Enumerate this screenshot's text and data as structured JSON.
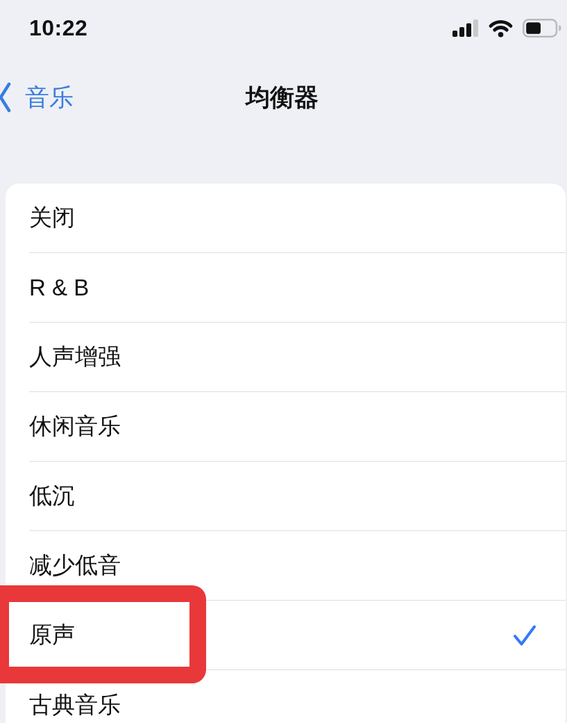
{
  "status_bar": {
    "time": "10:22"
  },
  "nav_bar": {
    "back_label": "音乐",
    "title": "均衡器"
  },
  "items": [
    {
      "label": "关闭",
      "selected": false,
      "highlighted": false
    },
    {
      "label": "R & B",
      "selected": false,
      "highlighted": false
    },
    {
      "label": "人声增强",
      "selected": false,
      "highlighted": false
    },
    {
      "label": "休闲音乐",
      "selected": false,
      "highlighted": false
    },
    {
      "label": "低沉",
      "selected": false,
      "highlighted": false
    },
    {
      "label": "减少低音",
      "selected": false,
      "highlighted": false
    },
    {
      "label": "原声",
      "selected": true,
      "highlighted": true
    },
    {
      "label": "古典音乐",
      "selected": false,
      "highlighted": false
    }
  ]
}
